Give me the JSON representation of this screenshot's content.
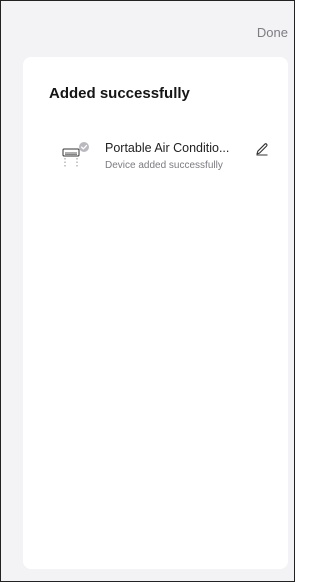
{
  "header": {
    "done_label": "Done"
  },
  "card": {
    "title": "Added successfully",
    "device": {
      "name": "Portable Air Conditio...",
      "status": "Device added successfully",
      "icon": "air-conditioner-icon",
      "badge_icon": "check-badge-icon",
      "edit_icon": "pencil-icon"
    }
  },
  "colors": {
    "background": "#f3f3f5",
    "card": "#ffffff",
    "title": "#151515",
    "secondary_text": "#7b7b80",
    "badge": "#b9b9be"
  }
}
